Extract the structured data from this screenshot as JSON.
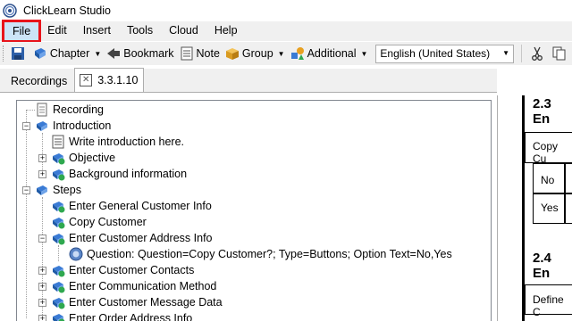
{
  "window": {
    "title": "ClickLearn Studio"
  },
  "menu": {
    "items": [
      "File",
      "Edit",
      "Insert",
      "Tools",
      "Cloud",
      "Help"
    ],
    "active": "File"
  },
  "toolbar": {
    "chapter_label": "Chapter",
    "bookmark_label": "Bookmark",
    "note_label": "Note",
    "group_label": "Group",
    "additional_label": "Additional",
    "language_value": "English (United States)"
  },
  "tabs": {
    "recordings": "Recordings",
    "doc": "3.3.1.10"
  },
  "tree": {
    "recording": "Recording",
    "introduction": "Introduction",
    "write_intro": "Write introduction here.",
    "objective": "Objective",
    "background": "Background information",
    "steps": "Steps",
    "step1": "Enter General Customer Info",
    "step2": "Copy Customer",
    "step3": "Enter Customer Address Info",
    "question": "Question: Question=Copy Customer?; Type=Buttons; Option Text=No,Yes",
    "step4": "Enter Customer Contacts",
    "step5": "Enter Communication Method",
    "step6": "Enter Customer Message Data",
    "step7": "Enter Order Address Info"
  },
  "preview": {
    "heading1": "2.3 En",
    "copy_cu": "Copy Cu",
    "no": "No",
    "yes": "Yes",
    "heading2": "2.4 En",
    "define_c": "Define C"
  },
  "colors": {
    "highlight_red": "#e8141b",
    "menu_active_bg": "#cce4f7",
    "chrome_bg": "#f0f0f0"
  }
}
